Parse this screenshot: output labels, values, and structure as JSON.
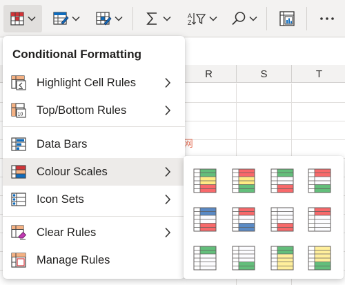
{
  "toolbar": {
    "buttons": [
      {
        "name": "conditional-formatting",
        "icon": "conditional-formatting-icon",
        "active": true
      },
      {
        "name": "format-as-table",
        "icon": "format-as-table-icon"
      },
      {
        "name": "cell-styles",
        "icon": "cell-styles-icon"
      },
      {
        "name": "autosum",
        "icon": "sigma-icon"
      },
      {
        "name": "sort-filter",
        "icon": "sort-filter-icon"
      },
      {
        "name": "find-select",
        "icon": "search-icon"
      },
      {
        "name": "analyze-data",
        "icon": "analyze-data-icon"
      },
      {
        "name": "more-options",
        "icon": "ellipsis-icon"
      }
    ]
  },
  "sheet": {
    "columns": [
      "R",
      "S",
      "T"
    ]
  },
  "watermark": "php中文网",
  "menu": {
    "title": "Conditional Formatting",
    "items": [
      {
        "label": "Highlight Cell Rules",
        "icon": "highlight-cell-rules-icon",
        "submenu": true
      },
      {
        "label": "Top/Bottom Rules",
        "icon": "top-bottom-rules-icon",
        "submenu": true
      },
      {
        "label": "Data Bars",
        "icon": "data-bars-icon",
        "submenu": false
      },
      {
        "label": "Colour Scales",
        "icon": "colour-scales-icon",
        "submenu": true,
        "hover": true
      },
      {
        "label": "Icon Sets",
        "icon": "icon-sets-icon",
        "submenu": true
      },
      {
        "label": "Clear Rules",
        "icon": "clear-rules-icon",
        "submenu": true
      },
      {
        "label": "Manage Rules",
        "icon": "manage-rules-icon",
        "submenu": false
      }
    ],
    "top10_label": "10"
  },
  "colour_scales": {
    "presets": [
      {
        "top": "#63be7b",
        "mid": "#ffeb84",
        "bottom": "#f8696b"
      },
      {
        "top": "#f8696b",
        "mid": "#ffeb84",
        "bottom": "#63be7b"
      },
      {
        "top": "#63be7b",
        "mid": "#fcfcff",
        "bottom": "#f8696b"
      },
      {
        "top": "#f8696b",
        "mid": "#fcfcff",
        "bottom": "#63be7b"
      },
      {
        "top": "#5a8ac6",
        "mid": "#fcfcff",
        "bottom": "#f8696b"
      },
      {
        "top": "#f8696b",
        "mid": "#fcfcff",
        "bottom": "#5a8ac6"
      },
      {
        "top": "#fcfcff",
        "mid": "#fcfcff",
        "bottom": "#f8696b"
      },
      {
        "top": "#f8696b",
        "mid": "#fcfcff",
        "bottom": "#fcfcff"
      },
      {
        "top": "#63be7b",
        "mid": "#fcfcff",
        "bottom": "#fcfcff"
      },
      {
        "top": "#fcfcff",
        "mid": "#fcfcff",
        "bottom": "#63be7b"
      },
      {
        "top": "#63be7b",
        "mid": "#ffef9c",
        "bottom": "#ffef9c"
      },
      {
        "top": "#ffef9c",
        "mid": "#ffef9c",
        "bottom": "#63be7b"
      }
    ]
  }
}
